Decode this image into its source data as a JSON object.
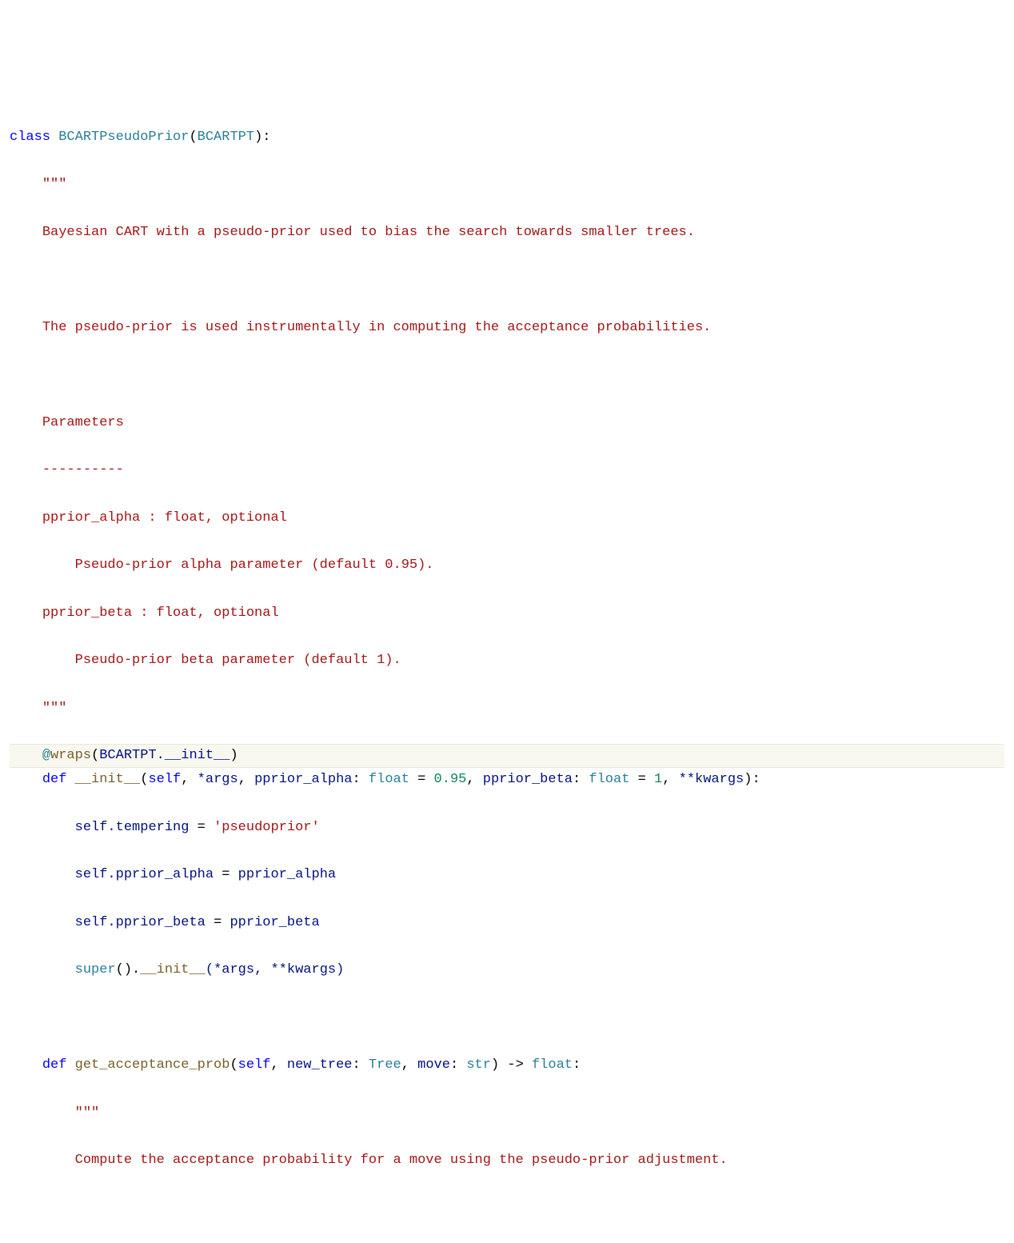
{
  "code": {
    "l01_kw_class": "class",
    "l01_name": "BCARTPseudoPrior",
    "l01_base": "BCARTPT",
    "triple_q": "\"\"\"",
    "doc_line1": "Bayesian CART with a pseudo-prior used to bias the search towards smaller trees.",
    "doc_line2": "The pseudo-prior is used instrumentally in computing the acceptance probabilities.",
    "doc_params_hdr": "Parameters",
    "doc_params_dash": "----------",
    "doc_pa": "pprior_alpha : float, optional",
    "doc_pa_desc": "Pseudo-prior alpha parameter (default 0.95).",
    "doc_pb": "pprior_beta : float, optional",
    "doc_pb_desc": "Pseudo-prior beta parameter (default 1).",
    "dec_at": "@",
    "dec_name": "wraps",
    "dec_arg": "BCARTPT.__init__",
    "kw_def": "def",
    "init_name": "__init__",
    "init_paren_open": "(",
    "init_self": "self",
    "init_args": "*args",
    "init_p1": "pprior_alpha",
    "init_t_float": "float",
    "init_p1_def": "0.95",
    "init_p2": "pprior_beta",
    "init_p2_def": "1",
    "init_kwargs": "**kwargs",
    "body_l1_lhs": "self.tempering",
    "body_l1_rhs": "'pseudoprior'",
    "body_l2_lhs": "self.pprior_alpha",
    "body_l2_rhs": "pprior_alpha",
    "body_l3_lhs": "self.pprior_beta",
    "body_l3_rhs": "pprior_beta",
    "body_l4": "().",
    "body_l4_super": "super",
    "body_l4_init": "__init__",
    "body_l4_args": "(*args, **kwargs)",
    "fn2_name": "get_acceptance_prob",
    "fn2_self": "self",
    "fn2_p1": "new_tree",
    "fn2_t1": "Tree",
    "fn2_p2": "move",
    "fn2_t2": "str",
    "fn2_ret": "float",
    "fn2_doc": "Compute the acceptance probability for a move using the pseudo-prior adjustment."
  }
}
